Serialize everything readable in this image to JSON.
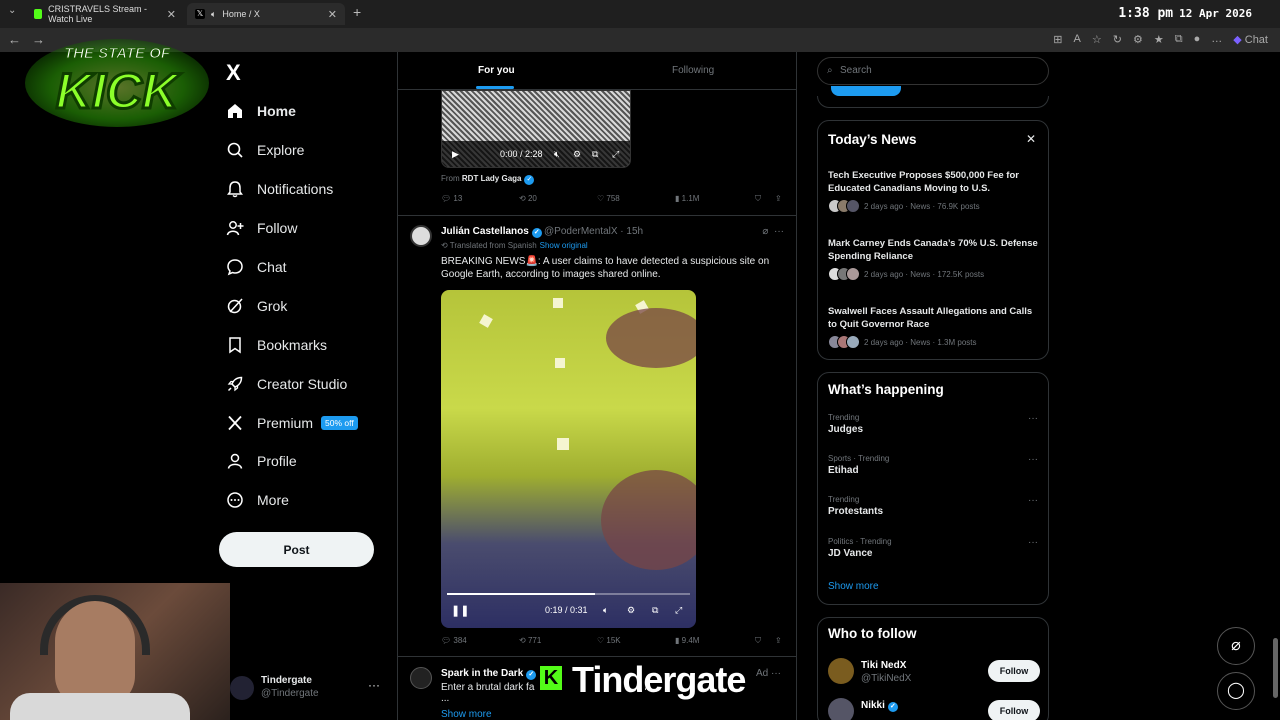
{
  "browser": {
    "tabs": [
      {
        "label": "CRISTRAVELS Stream - Watch Live"
      },
      {
        "label": "Home / X"
      }
    ],
    "new_tab": "+",
    "clock": {
      "time": "1:38 pm",
      "date": "12 Apr 2026"
    },
    "chat_label": "Chat"
  },
  "overlay": {
    "stream_logo_lines": [
      "THE STATE OF",
      "KICK"
    ],
    "streamer_name": "Tindergate",
    "kick_letter": "K"
  },
  "sidebar": {
    "logo": "X",
    "items": [
      {
        "label": "Home",
        "icon": "home-icon"
      },
      {
        "label": "Explore",
        "icon": "search-icon"
      },
      {
        "label": "Notifications",
        "icon": "bell-icon"
      },
      {
        "label": "Follow",
        "icon": "person-add-icon"
      },
      {
        "label": "Chat",
        "icon": "chat-icon"
      },
      {
        "label": "Grok",
        "icon": "grok-icon"
      },
      {
        "label": "Bookmarks",
        "icon": "bookmark-icon"
      },
      {
        "label": "Creator Studio",
        "icon": "rocket-icon"
      },
      {
        "label": "Premium",
        "icon": "x-logo-icon",
        "badge": "50% off"
      },
      {
        "label": "Profile",
        "icon": "person-icon"
      },
      {
        "label": "More",
        "icon": "more-circle-icon"
      }
    ],
    "post_button": "Post",
    "account": {
      "name": "Tindergate",
      "handle": "@Tindergate"
    }
  },
  "feed": {
    "tabs": [
      "For you",
      "Following"
    ],
    "post1": {
      "video_time": "0:00 / 2:28",
      "from_prefix": "From",
      "from_name": "RDT Lady Gaga",
      "replies": "13",
      "reposts": "20",
      "likes": "758",
      "views": "1.1M"
    },
    "post2": {
      "author": "Julián Castellanos",
      "handle_time": "@PoderMentalX · 15h",
      "translated": "Translated from Spanish",
      "show_original": "Show original",
      "text": "BREAKING NEWS🚨: A user claims to have detected a suspicious site on Google Earth, according to images shared online.",
      "video_time": "0:19 / 0:31",
      "video_progress": 0.61,
      "replies": "384",
      "reposts": "771",
      "likes": "15K",
      "views": "9.4M"
    },
    "post3": {
      "author": "Spark in the Dark",
      "text": "Enter a brutal dark fa",
      "text2": "lu",
      "ellipsis": "...",
      "show_more": "Show more",
      "ad_label": "Ad"
    }
  },
  "right": {
    "search_placeholder": "Search",
    "todays_news": {
      "title": "Today’s News",
      "items": [
        {
          "headline": "Tech Executive Proposes $500,000 Fee for Educated Canadians Moving to U.S.",
          "meta": "2 days ago · News · 76.9K posts"
        },
        {
          "headline": "Mark Carney Ends Canada’s 70% U.S. Defense Spending Reliance",
          "meta": "2 days ago · News · 172.5K posts"
        },
        {
          "headline": "Swalwell Faces Assault Allegations and Calls to Quit Governor Race",
          "meta": "2 days ago · News · 1.3M posts"
        }
      ]
    },
    "whats_happening": {
      "title": "What’s happening",
      "items": [
        {
          "context": "Trending",
          "name": "Judges"
        },
        {
          "context": "Sports · Trending",
          "name": "Etihad"
        },
        {
          "context": "Trending",
          "name": "Protestants"
        },
        {
          "context": "Politics · Trending",
          "name": "JD Vance"
        }
      ],
      "show_more": "Show more"
    },
    "who_to_follow": {
      "title": "Who to follow",
      "accounts": [
        {
          "name": "Tiki NedX",
          "handle": "@TikiNedX",
          "button": "Follow"
        },
        {
          "name": "Nikki",
          "handle": "",
          "button": "Follow"
        }
      ]
    }
  },
  "colors": {
    "accent": "#1d9bf0",
    "kick_green": "#53fc18",
    "background": "#000000"
  }
}
